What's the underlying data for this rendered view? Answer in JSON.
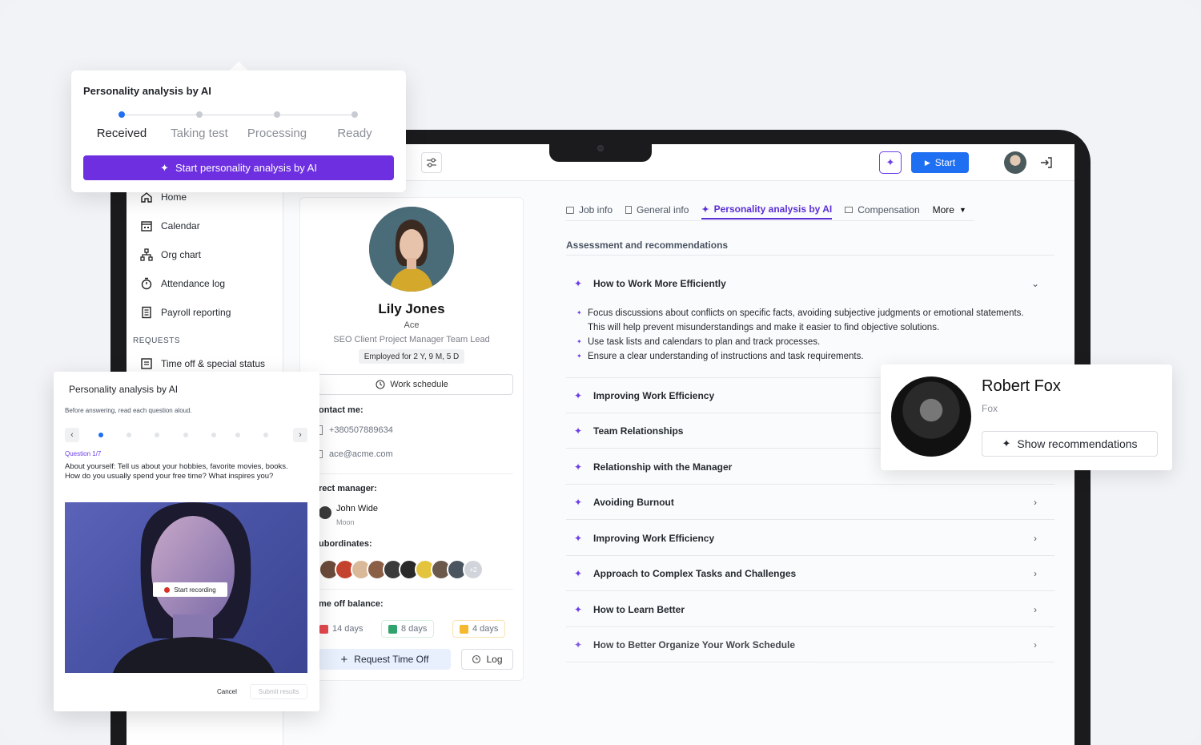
{
  "popup": {
    "title": "Personality analysis by AI",
    "steps": [
      "Received",
      "Taking test",
      "Processing",
      "Ready"
    ],
    "active_step": 0,
    "start_label": "Start personality analysis by AI",
    "accent": "#6d2fe0"
  },
  "topbar": {
    "start_label": "Start",
    "start_color": "#1f6ff2"
  },
  "sidebar": {
    "items": [
      {
        "label": "Home",
        "icon": "home-icon"
      },
      {
        "label": "Calendar",
        "icon": "calendar-icon"
      },
      {
        "label": "Org chart",
        "icon": "org-chart-icon"
      },
      {
        "label": "Attendance log",
        "icon": "stopwatch-icon"
      },
      {
        "label": "Payroll reporting",
        "icon": "document-icon"
      }
    ],
    "section_requests": "REQUESTS",
    "request_items": [
      {
        "label": "Time off & special status",
        "icon": "list-icon"
      }
    ]
  },
  "profile": {
    "name": "Lily Jones",
    "nickname": "Ace",
    "role": "SEO Client Project Manager Team Lead",
    "employed": "Employed for 2 Y, 9 M, 5 D",
    "work_schedule": "Work schedule",
    "contact_label": "ontact me:",
    "phone": "+380507889634",
    "email": "ace@acme.com",
    "manager_label": "rect manager:",
    "manager_name": "John Wide",
    "manager_sub": "Moon",
    "subordinates_label": "ubordinates:",
    "subordinates_more": "+2",
    "time_off_label": "me off balance:",
    "balances": [
      {
        "label": "14 days",
        "color": "#e5484d"
      },
      {
        "label": "8 days",
        "color": "#30a46c"
      },
      {
        "label": "4 days",
        "color": "#f5b82e"
      }
    ],
    "request_time_off": "Request Time Off",
    "log": "Log"
  },
  "main": {
    "tabs": [
      {
        "label": "Job info",
        "icon": "briefcase-icon",
        "active": false
      },
      {
        "label": "General info",
        "icon": "file-icon",
        "active": false
      },
      {
        "label": "Personality analysis by AI",
        "icon": "sparkle-icon",
        "active": true
      },
      {
        "label": "Compensation",
        "icon": "card-icon",
        "active": false
      },
      {
        "label": "More",
        "icon": "chevron-down-icon",
        "active": false
      }
    ],
    "section_title": "Assessment and recommendations",
    "expanded": {
      "title": "How to Work More Efficiently",
      "bullets": [
        "Focus discussions about conflicts on specific facts, avoiding subjective judgments or emotional statements. This will help prevent misunderstandings and make it easier to find objective solutions.",
        "Use task lists and calendars to plan and track processes.",
        "Ensure a clear understanding of instructions and task requirements."
      ]
    },
    "rows": [
      "Improving Work Efficiency",
      "Team Relationships",
      "Relationship with the Manager",
      "Avoiding Burnout",
      "Improving Work Efficiency",
      "Approach to Complex Tasks and Challenges",
      "How to Learn Better",
      "How to Better Organize Your Work Schedule"
    ]
  },
  "robert": {
    "name": "Robert Fox",
    "sub": "Fox",
    "button": "Show recommendations"
  },
  "question_modal": {
    "title": "Personality analysis by AI",
    "hint": "Before answering, read each question aloud.",
    "question_num": "Question 1/7",
    "total_questions": 7,
    "current_question": 1,
    "question": "About yourself: Tell us about your hobbies, favorite movies, books. How do you usually spend your free time? What inspires you?",
    "record_label": "Start recording",
    "cancel": "Cancel",
    "submit": "Submit results"
  }
}
